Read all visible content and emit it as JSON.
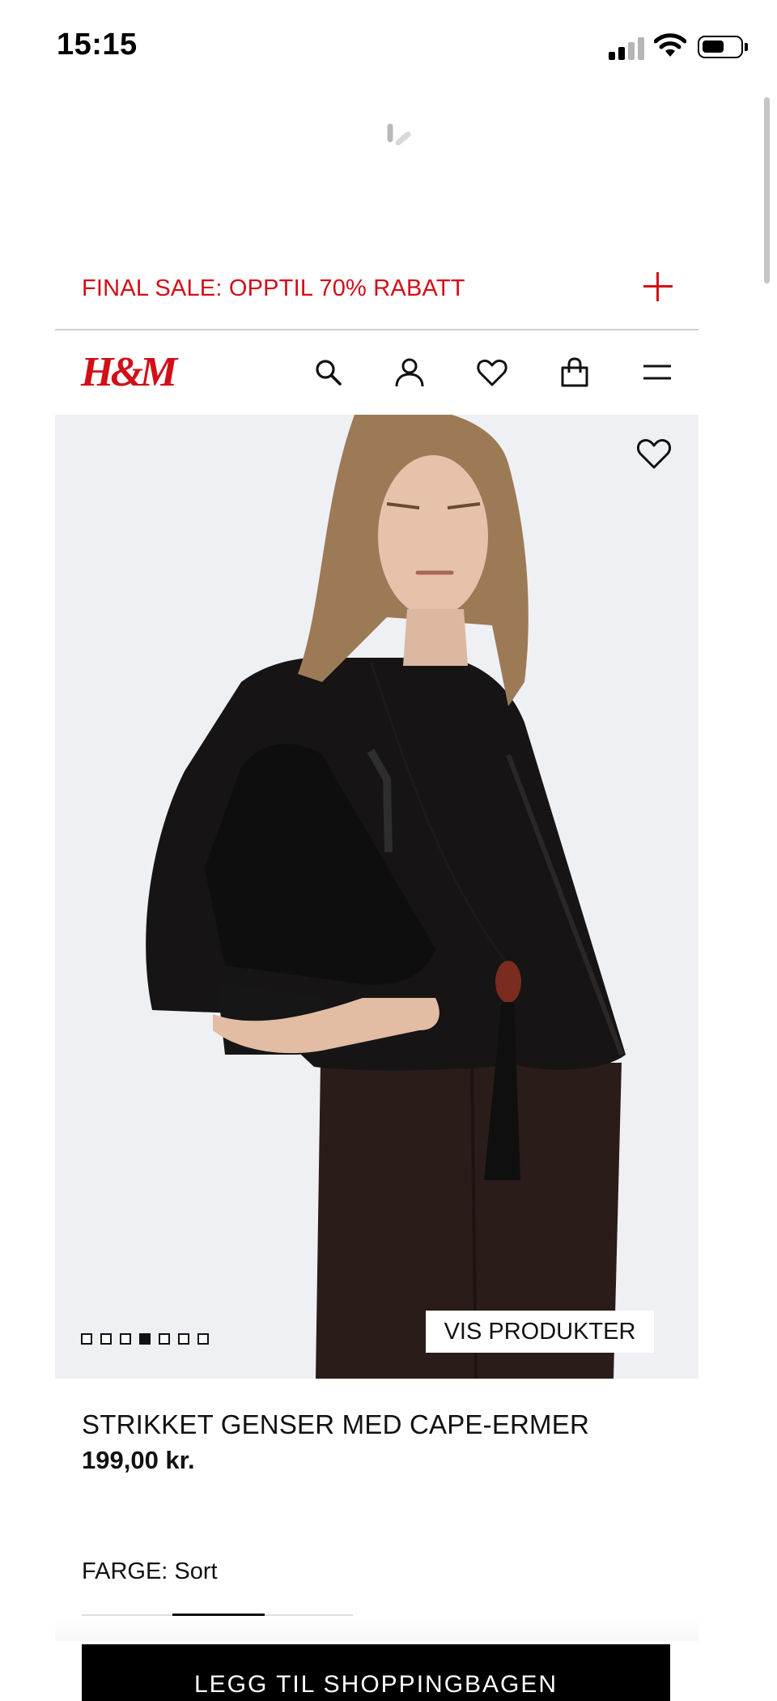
{
  "status_bar": {
    "time": "15:15"
  },
  "promo": {
    "text": "FINAL SALE: OPPTIL 70% RABATT",
    "icon": "plus-icon"
  },
  "header": {
    "logo": "H&M",
    "icons": [
      "search-icon",
      "account-icon",
      "favorites-icon",
      "shopping-bag-icon",
      "menu-icon"
    ]
  },
  "hero": {
    "favorite_icon": "heart-icon",
    "image_count": 7,
    "active_image_index": 4,
    "view_products_label": "VIS PRODUKTER"
  },
  "product": {
    "name": "STRIKKET GENSER MED CAPE-ERMER",
    "price": "199,00 kr.",
    "color_label": "FARGE: Sort"
  },
  "cta": {
    "add_to_bag_label": "LEGG TIL SHOPPINGBAGEN"
  },
  "colors": {
    "brand": "#d20e17",
    "text": "#111111",
    "cta_bg": "#000000"
  }
}
